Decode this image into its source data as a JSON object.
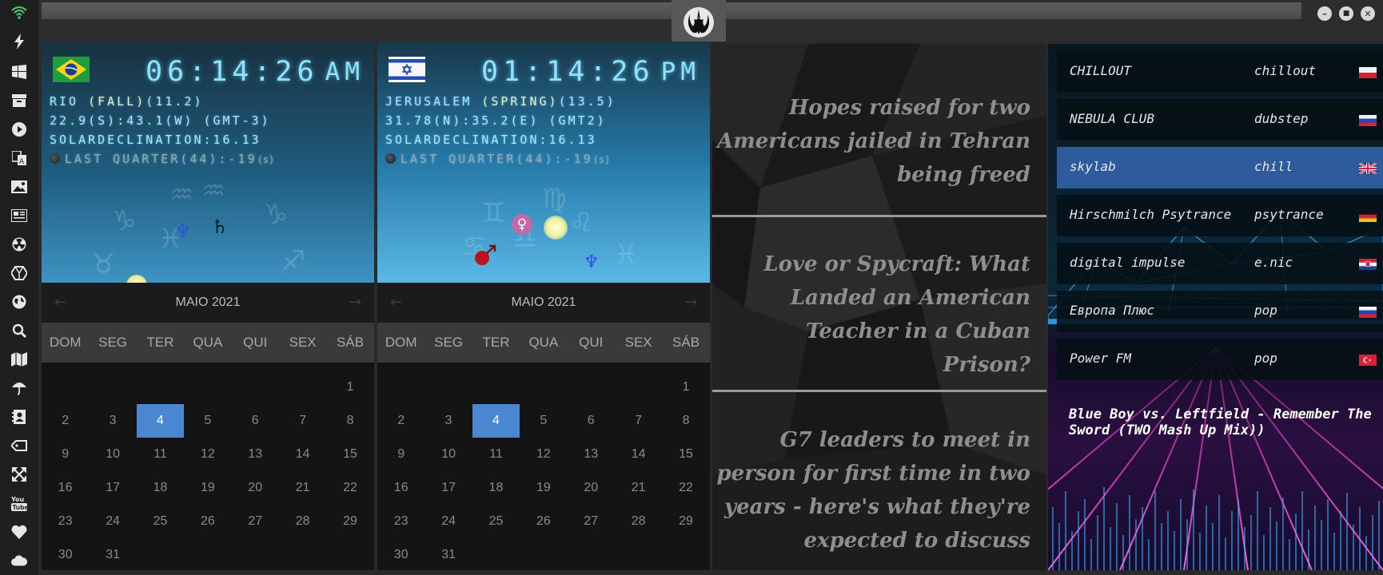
{
  "window": {
    "logo": "rebel-alliance-logo",
    "minimize": "–",
    "maximize": "■",
    "close": "✕"
  },
  "sidebar": {
    "icons": [
      "wifi-icon",
      "lightning-icon",
      "windows-icon",
      "archive-icon",
      "play-icon",
      "translate-icon",
      "image-icon",
      "news-icon",
      "radiation-icon",
      "hexagon-icon",
      "globe-icon",
      "search-icon",
      "map-icon",
      "umbrella-icon",
      "contacts-icon",
      "tag-icon",
      "fullscreen-icon",
      "youtube-icon",
      "heart-icon",
      "cloud-icon"
    ]
  },
  "clocks": [
    {
      "flag": "brazil",
      "time": "06:14:26",
      "ampm": "AM",
      "line1_pre": "RIO ",
      "line1_hl": "(FALL)",
      "line1_post": "(11.2)",
      "line2": "22.9(S):43.1(W) (GMT-3)",
      "line3": "SOLARDECLINATION:16.13",
      "line4": "LAST QUARTER(44):-19",
      "line4_suffix": "(s)",
      "calendar": {
        "month": "MAIO 2021",
        "dows": [
          "DOM",
          "SEG",
          "TER",
          "QUA",
          "QUI",
          "SEX",
          "SÁB"
        ],
        "days": [
          "1",
          "2",
          "3",
          "4",
          "5",
          "6",
          "7",
          "8",
          "9",
          "10",
          "11",
          "12",
          "13",
          "14",
          "15",
          "16",
          "17",
          "18",
          "19",
          "20",
          "21",
          "22",
          "23",
          "24",
          "25",
          "26",
          "27",
          "28",
          "29",
          "30",
          "31"
        ],
        "selected": "4"
      }
    },
    {
      "flag": "israel",
      "time": "01:14:26",
      "ampm": "PM",
      "line1_pre": "JERUSALEM ",
      "line1_hl": "(SPRING)",
      "line1_post": "(13.5)",
      "line2": "31.78(N):35.2(E) (GMT2)",
      "line3": "SOLARDECLINATION:16.13",
      "line4": "LAST QUARTER(44):-19",
      "line4_suffix": "(s)",
      "calendar": {
        "month": "MAIO 2021",
        "dows": [
          "DOM",
          "SEG",
          "TER",
          "QUA",
          "QUI",
          "SEX",
          "SÁB"
        ],
        "days": [
          "1",
          "2",
          "3",
          "4",
          "5",
          "6",
          "7",
          "8",
          "9",
          "10",
          "11",
          "12",
          "13",
          "14",
          "15",
          "16",
          "17",
          "18",
          "19",
          "20",
          "21",
          "22",
          "23",
          "24",
          "25",
          "26",
          "27",
          "28",
          "29",
          "30",
          "31"
        ],
        "selected": "4"
      }
    }
  ],
  "zodiac_glyphs": {
    "capricorn": "♑",
    "aquarius": "♒",
    "cancer": "♋",
    "sagittarius": "♐",
    "taurus": "♉",
    "pisces": "♓",
    "virgo": "♍",
    "libra": "♎",
    "gemini": "♊",
    "leo": "♌"
  },
  "planets": {
    "neptune": "♆",
    "saturn": "♄",
    "venus": "♀",
    "mars": "♂"
  },
  "news": [
    {
      "headline": "Hopes raised for two Americans jailed in Tehran being freed"
    },
    {
      "headline": "Love or Spycraft: What Landed an American Teacher in a Cuban Prison?"
    },
    {
      "headline": "G7 leaders to meet in person for first time in two years - here's what they're expected to discuss"
    }
  ],
  "radio": {
    "stations": [
      {
        "name": "CHILLOUT",
        "genre": "chillout",
        "flag": "poland"
      },
      {
        "name": "NEBULA CLUB",
        "genre": "dubstep",
        "flag": "russia"
      },
      {
        "name": "skylab",
        "genre": "chill",
        "flag": "uk",
        "selected": true
      },
      {
        "name": "Hirschmilch Psytrance",
        "genre": "psytrance",
        "flag": "germany"
      },
      {
        "name": "digital impulse",
        "genre": "e.nic",
        "flag": "croatia"
      },
      {
        "name": "Европа Плюс",
        "genre": "pop",
        "flag": "russia"
      },
      {
        "name": "Power FM",
        "genre": "pop",
        "flag": "turkey"
      }
    ],
    "now_playing": "Blue Boy vs. Leftfield - Remember The Sword (TWO Mash Up Mix))"
  },
  "colors": {
    "accent": "#4a87d0",
    "clock_text": "#8ee3ff",
    "selected_station": "#2e5b9b"
  }
}
